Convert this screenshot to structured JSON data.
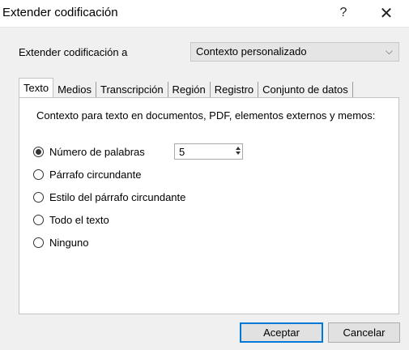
{
  "window": {
    "title": "Extender codificación",
    "help_label": "?",
    "close_label": "✕"
  },
  "extend": {
    "label": "Extender codificación a",
    "combo_value": "Contexto personalizado",
    "combo_arrow": "⌵"
  },
  "tabs": [
    {
      "label": "Texto",
      "active": true
    },
    {
      "label": "Medios",
      "active": false
    },
    {
      "label": "Transcripción",
      "active": false
    },
    {
      "label": "Región",
      "active": false
    },
    {
      "label": "Registro",
      "active": false
    },
    {
      "label": "Conjunto de datos",
      "active": false
    }
  ],
  "panel": {
    "description": "Contexto para texto en documentos, PDF, elementos externos y memos:",
    "options": [
      {
        "label": "Número de palabras",
        "checked": true
      },
      {
        "label": "Párrafo circundante",
        "checked": false
      },
      {
        "label": "Estilo del párrafo circundante",
        "checked": false
      },
      {
        "label": "Todo el texto",
        "checked": false
      },
      {
        "label": "Ninguno",
        "checked": false
      }
    ],
    "word_count": "5"
  },
  "buttons": {
    "ok": "Aceptar",
    "cancel": "Cancelar"
  }
}
